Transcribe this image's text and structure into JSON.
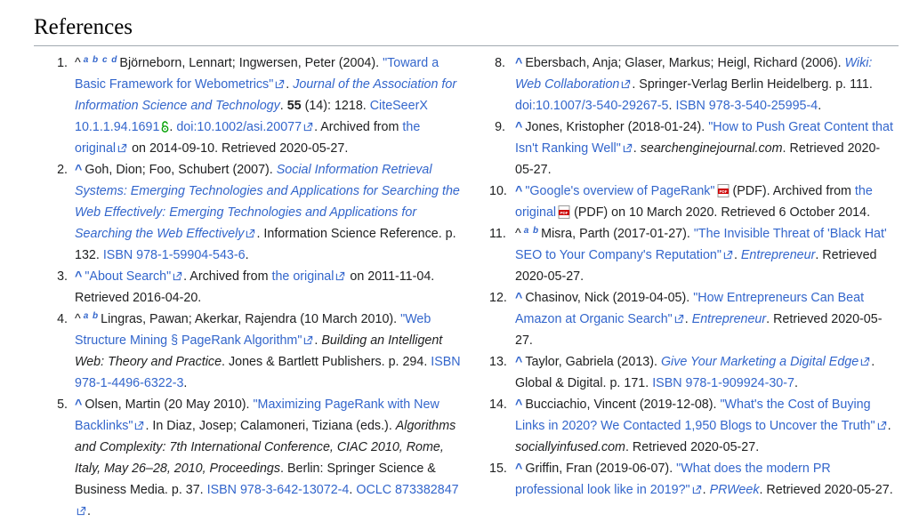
{
  "heading": "References",
  "refs": [
    {
      "num": "1.",
      "marks": "a b c d",
      "t1": "Björneborn, Lennart; Ingwersen, Peter (2004). ",
      "l1": "\"Toward a Basic Framework for Webometrics\"",
      "t2": ". ",
      "i1": "Journal of the Association for Information Science and Technology",
      "t3": ". ",
      "b1": "55",
      "t4": " (14): 1218. ",
      "l2": "CiteSeerX 10.1.1.94.1691",
      "t5": ". ",
      "l3": "doi:10.1002/asi.20077",
      "t6": ". Archived from ",
      "l4": "the original",
      "t7": " on 2014-09-10. Retrieved 2020-05-27."
    },
    {
      "num": "2.",
      "caret": "^",
      "t1": "Goh, Dion; Foo, Schubert (2007). ",
      "l1": "Social Information Retrieval Systems: Emerging Technologies and Applications for Searching the Web Effectively: Emerging Technologies and Applications for Searching the Web Effectively",
      "t2": ". Information Science Reference. p. 132. ",
      "l2": "ISBN 978-1-59904-543-6",
      "t3": "."
    },
    {
      "num": "3.",
      "caret": "^",
      "l1": "\"About Search\"",
      "t1": ". Archived from ",
      "l2": "the original",
      "t2": " on 2011-11-04. Retrieved 2016-04-20."
    },
    {
      "num": "4.",
      "marks": "a b",
      "t1": "Lingras, Pawan; Akerkar, Rajendra (10 March 2010). ",
      "l1": "\"Web Structure Mining § PageRank Algorithm\"",
      "t2": ". ",
      "i1": "Building an Intelligent Web: Theory and Practice",
      "t3": ". Jones & Bartlett Publishers. p. 294. ",
      "l2": "ISBN 978-1-4496-6322-3",
      "t4": "."
    },
    {
      "num": "5.",
      "caret": "^",
      "t1": "Olsen, Martin (20 May 2010). ",
      "l1": "\"Maximizing PageRank with New Backlinks\"",
      "t2": ". In Diaz, Josep; Calamoneri, Tiziana (eds.). ",
      "i1": "Algorithms and Complexity: 7th International Conference, CIAC 2010, Rome, Italy, May 26–28, 2010, Proceedings",
      "t3": ". Berlin: Springer Science & Business Media. p. 37. ",
      "l2": "ISBN 978-3-642-13072-4",
      "t4": ". ",
      "l3": "OCLC 873382847",
      "t5": "."
    },
    {
      "num": "8.",
      "caret": "^",
      "t1": "Ebersbach, Anja; Glaser, Markus; Heigl, Richard (2006). ",
      "l1": "Wiki: Web Collaboration",
      "t2": ". Springer-Verlag Berlin Heidelberg. p. 111. ",
      "l2": "doi:10.1007/3-540-29267-5",
      "t3": ". ",
      "l3": "ISBN 978-3-540-25995-4",
      "t4": "."
    },
    {
      "num": "9.",
      "caret": "^",
      "t1": "Jones, Kristopher (2018-01-24). ",
      "l1": "\"How to Push Great Content that Isn't Ranking Well\"",
      "t2": ". ",
      "i1": "searchenginejournal.com",
      "t3": ". Retrieved 2020-05-27."
    },
    {
      "num": "10.",
      "caret": "^",
      "l1": "\"Google's overview of PageRank\"",
      "t1": " (PDF). Archived from ",
      "l2": "the original",
      "t2": " (PDF) on 10 March 2020. Retrieved 6 October 2014."
    },
    {
      "num": "11.",
      "marks": "a b",
      "t1": "Misra, Parth (2017-01-27). ",
      "l1": "\"The Invisible Threat of 'Black Hat' SEO to Your Company's Reputation\"",
      "t2": ". ",
      "i1": "Entrepreneur",
      "t3": ". Retrieved 2020-05-27."
    },
    {
      "num": "12.",
      "caret": "^",
      "t1": "Chasinov, Nick (2019-04-05). ",
      "l1": "\"How Entrepreneurs Can Beat Amazon at Organic Search\"",
      "t2": ". ",
      "i1": "Entrepreneur",
      "t3": ". Retrieved 2020-05-27."
    },
    {
      "num": "13.",
      "caret": "^",
      "t1": "Taylor, Gabriela (2013). ",
      "l1": "Give Your Marketing a Digital Edge",
      "t2": ". Global & Digital. p. 171. ",
      "l2": "ISBN 978-1-909924-30-7",
      "t3": "."
    },
    {
      "num": "14.",
      "caret": "^",
      "t1": "Bucciachio, Vincent (2019-12-08). ",
      "l1": "\"What's the Cost of Buying Links in 2020? We Contacted 1,950 Blogs to Uncover the Truth\"",
      "t2": ". ",
      "i1": "sociallyinfused.com",
      "t3": ". Retrieved 2020-05-27."
    },
    {
      "num": "15.",
      "caret": "^",
      "t1": "Griffin, Fran (2019-06-07). ",
      "l1": "\"What does the modern PR professional look like in 2019?\"",
      "t2": ". ",
      "i1": "PRWeek",
      "t3": ". Retrieved 2020-05-27."
    }
  ],
  "colors": {
    "link": "#3366cc",
    "text": "#202122",
    "rule": "#a2a9b1",
    "open_access": "#00a000",
    "pdf": "#cc0000"
  },
  "icons": [
    "external-link-icon",
    "open-access-lock-icon",
    "pdf-icon"
  ]
}
